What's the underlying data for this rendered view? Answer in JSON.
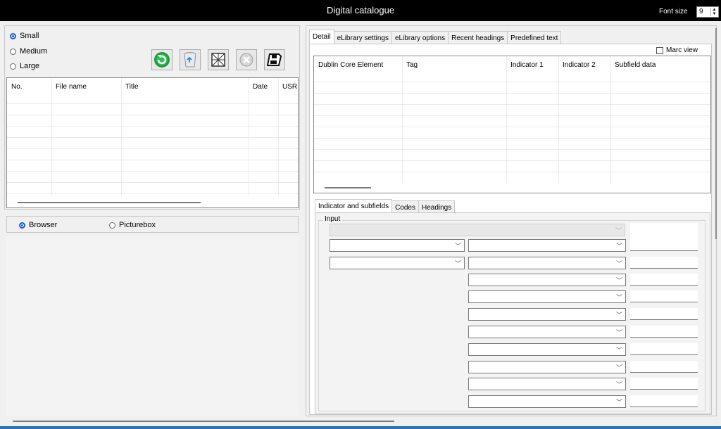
{
  "window": {
    "title": "Digital catalogue",
    "font_size_label": "Font size",
    "font_size_value": "9"
  },
  "size_options": {
    "small": "Small",
    "medium": "Medium",
    "large": "Large",
    "selected": "Small"
  },
  "toolbar": {
    "refresh": "refresh-icon",
    "delete": "recycle-bin-icon",
    "crop": "crop-frame-icon",
    "cancel": "cancel-icon",
    "save": "floppy-disk-icon"
  },
  "file_table": {
    "columns": [
      "No.",
      "File name",
      "Title",
      "Date",
      "USRI"
    ]
  },
  "viewer": {
    "browser": "Browser",
    "picturebox": "Picturebox",
    "selected": "Browser"
  },
  "detail_tabs": [
    "Detail",
    "eLibrary settings",
    "eLibrary options",
    "Recent headings",
    "Predefined text"
  ],
  "marc_view": {
    "label": "Marc view",
    "checked": false
  },
  "element_table": {
    "columns": [
      "Dublin Core Element",
      "Tag",
      "Indicator 1",
      "Indicator 2",
      "Subfield data"
    ]
  },
  "sub_tabs": [
    "Indicator and subfields",
    "Codes",
    "Headings"
  ],
  "input_group": {
    "label": "Input"
  },
  "colors": {
    "title_bg": "#000000",
    "radio_accent": "#1a5fc4"
  }
}
